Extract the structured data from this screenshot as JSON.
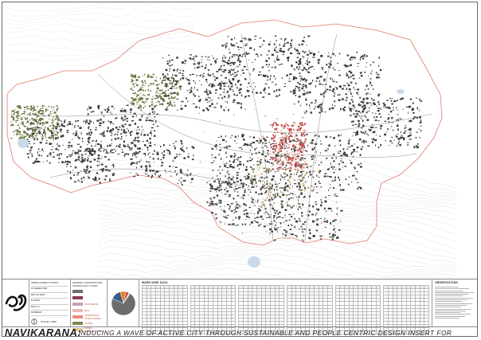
{
  "title": {
    "main": "NAVIKARANA:",
    "subtitle": "INDUCING A WAVE OF ACTIVE CITY THROUGH SUSTAINABLE AND PEOPLE CENTRIC DESIGN INSERT FOR JAMKHANDI"
  },
  "studio_info": {
    "lines": [
      "URBAN INSERT STUDIO",
      "IX SEMESTER",
      "BATCH 2024",
      "B.ARCH",
      "BLD 7U",
      "DIVBEAD"
    ],
    "scale": "SCALE 1:4000"
  },
  "legend": {
    "heading": "LEGEND CONSTRUCTION TECHNOLOGY LAYER",
    "items": [
      {
        "label": "",
        "color": "#6d6d6d"
      },
      {
        "label": "",
        "color": "#8a3a4e"
      },
      {
        "label": "CONCRETE",
        "color": "#c8a0b0"
      },
      {
        "label": "RCC",
        "color": "#e8b9b9"
      },
      {
        "label": "TEMPORARY STRUCTURES",
        "color": "#e98b7f"
      },
      {
        "label": "STONE",
        "color": "#7f8a4a"
      },
      {
        "label": "MIXED CONSTRUCTION",
        "color": "#d9c995"
      }
    ]
  },
  "pie": {
    "values": [
      72,
      14,
      8,
      4,
      2
    ],
    "colors": [
      "#6d6d6d",
      "#3c5a8c",
      "#e0862c",
      "#c94444",
      "#d8d8d8"
    ]
  },
  "ward_table": {
    "heading": "WARD WISE DATA"
  },
  "observations": {
    "heading": "OBSERVATIONS"
  },
  "colors": {
    "boundary": "#e0786a",
    "building": "#3a3a3a",
    "stone": "#7f8a4a",
    "core_red": "#c0504d",
    "contour": "#d0d0d0"
  }
}
